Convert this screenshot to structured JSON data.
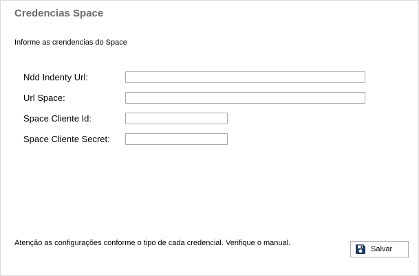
{
  "panel": {
    "title": "Credencias Space",
    "subtitle": "Informe as crendencias do Space"
  },
  "fields": {
    "ndd_identy_url": {
      "label": "Ndd Indenty Url:",
      "value": "",
      "placeholder": ""
    },
    "url_space": {
      "label": "Url Space:",
      "value": "",
      "placeholder": ""
    },
    "space_cliente_id": {
      "label": "Space Cliente Id:",
      "value": "",
      "placeholder": ""
    },
    "space_cliente_secret": {
      "label": "Space Cliente Secret:",
      "value": "",
      "placeholder": ""
    }
  },
  "footer": {
    "note": "Atenção as configurações conforme o tipo de cada credencial. Verifique o manual.",
    "save_label": "Salvar",
    "save_icon": "floppy-disk-icon"
  },
  "colors": {
    "title": "#6b6b6b",
    "icon": "#1f3a5f",
    "input_border": "#a9a9a9",
    "panel_border": "#d9d9d9"
  }
}
